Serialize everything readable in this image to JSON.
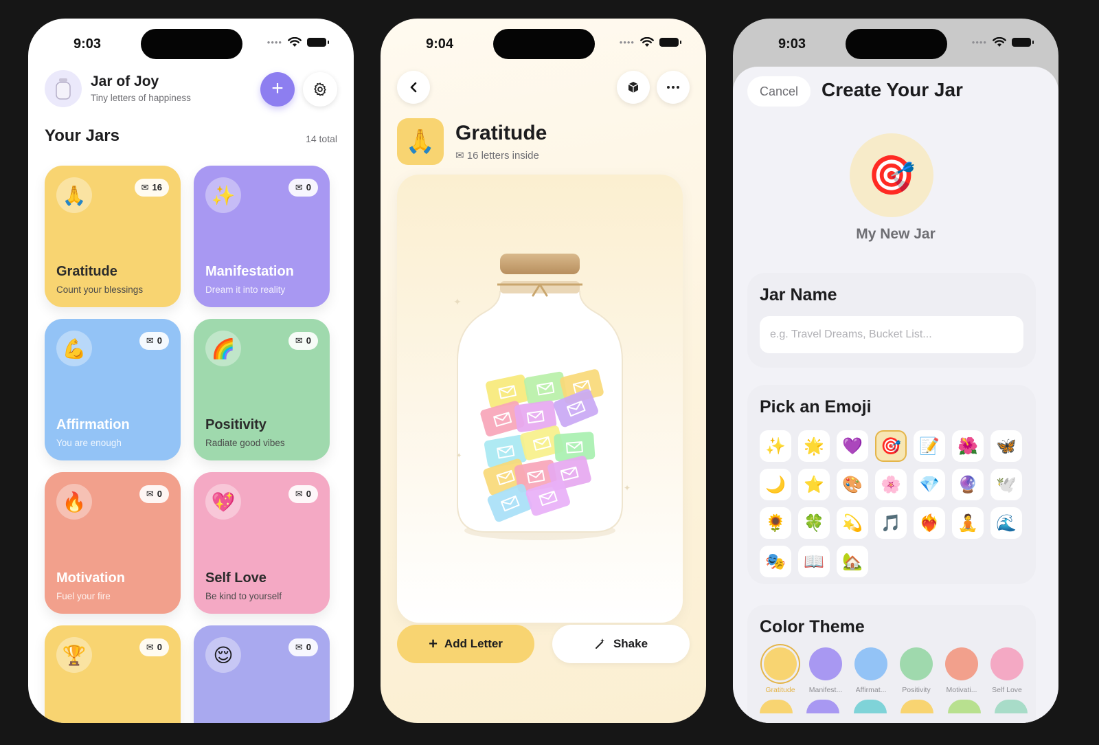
{
  "screen1": {
    "time": "9:03",
    "app_title": "Jar of Joy",
    "app_subtitle": "Tiny letters of happiness",
    "add_label": "+",
    "section_title": "Your Jars",
    "section_count": "14 total",
    "jars": [
      {
        "emoji": "🙏",
        "count": "16",
        "name": "Gratitude",
        "desc": "Count your blessings",
        "color": "#f8d471"
      },
      {
        "emoji": "✨",
        "count": "0",
        "name": "Manifestation",
        "desc": "Dream it into reality",
        "color": "#a898f2"
      },
      {
        "emoji": "💪",
        "count": "0",
        "name": "Affirmation",
        "desc": "You are enough",
        "color": "#93c3f6"
      },
      {
        "emoji": "🌈",
        "count": "0",
        "name": "Positivity",
        "desc": "Radiate good vibes",
        "color": "#9fd9ad"
      },
      {
        "emoji": "🔥",
        "count": "0",
        "name": "Motivation",
        "desc": "Fuel your fire",
        "color": "#f2a08c"
      },
      {
        "emoji": "💖",
        "count": "0",
        "name": "Self Love",
        "desc": "Be kind to yourself",
        "color": "#f4a9c4"
      },
      {
        "emoji": "🏆",
        "count": "0",
        "name": "",
        "desc": "",
        "color": "#f8d471"
      },
      {
        "emoji": "😌",
        "count": "0",
        "name": "",
        "desc": "",
        "color": "#a9a9ef"
      }
    ]
  },
  "screen2": {
    "time": "9:04",
    "jar_emoji": "🙏",
    "title": "Gratitude",
    "subtitle": "16 letters inside",
    "add_letter_label": "Add Letter",
    "shake_label": "Shake",
    "letter_colors": [
      "#f7e97a",
      "#b8f0a8",
      "#f9d978",
      "#f7a5b8",
      "#e6a8f0",
      "#c9a8f4",
      "#a8e8f2",
      "#f7f08a",
      "#a8f0b0",
      "#f9d978",
      "#f7a5b8",
      "#e6a8f0",
      "#a8e0f7",
      "#e8b0f7"
    ]
  },
  "screen3": {
    "time": "9:03",
    "cancel_label": "Cancel",
    "title": "Create Your Jar",
    "preview_emoji": "🎯",
    "preview_name": "My New Jar",
    "jar_name_label": "Jar Name",
    "jar_name_placeholder": "e.g. Travel Dreams, Bucket List...",
    "emoji_label": "Pick an Emoji",
    "emojis": [
      "✨",
      "🌟",
      "💜",
      "🎯",
      "📝",
      "🌺",
      "🦋",
      "🌙",
      "⭐",
      "🎨",
      "🌸",
      "💎",
      "🔮",
      "🕊️",
      "🌻",
      "🍀",
      "💫",
      "🎵",
      "❤️‍🔥",
      "🧘",
      "🌊",
      "🎭",
      "📖",
      "🏡"
    ],
    "selected_emoji_index": 3,
    "color_label": "Color Theme",
    "colors": [
      {
        "name": "Gratitude",
        "hex": "#f8d471"
      },
      {
        "name": "Manifest...",
        "hex": "#a898f2"
      },
      {
        "name": "Affirmat...",
        "hex": "#93c3f6"
      },
      {
        "name": "Positivity",
        "hex": "#9fd9ad"
      },
      {
        "name": "Motivati...",
        "hex": "#f2a08c"
      },
      {
        "name": "Self Love",
        "hex": "#f4a9c4"
      }
    ],
    "peek_colors": [
      "#f8d471",
      "#a898f2",
      "#7fd3d8",
      "#f8d471",
      "#b8e08f",
      "#a8dcc8"
    ],
    "selected_color_index": 0
  }
}
